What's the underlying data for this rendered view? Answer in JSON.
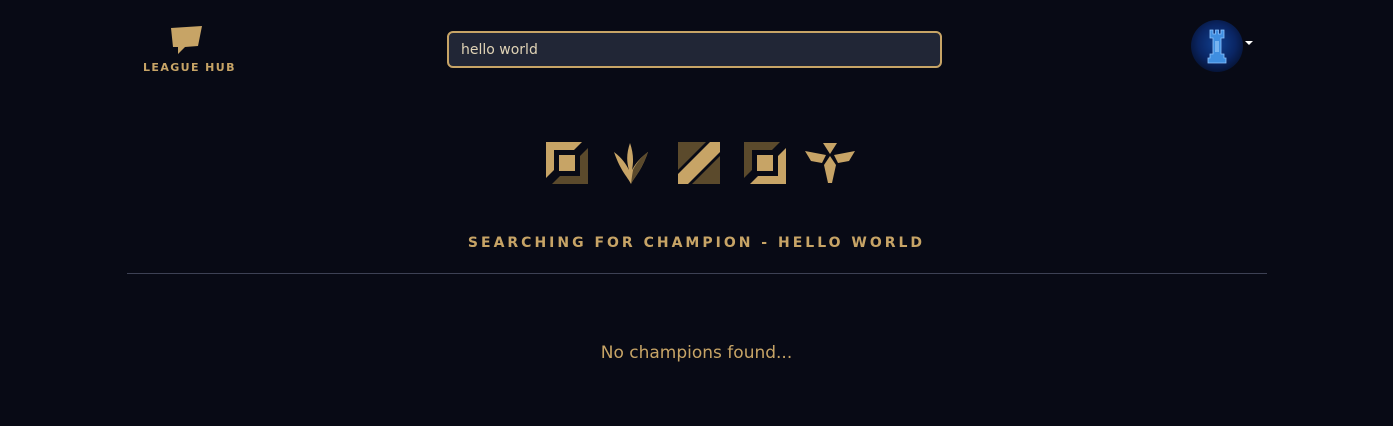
{
  "header": {
    "logo_text": "LEAGUE HUB",
    "search": {
      "value": "hello world",
      "placeholder": ""
    },
    "avatar_icon": "profile-avatar-icon"
  },
  "roles": {
    "items": [
      {
        "icon": "top-lane-icon"
      },
      {
        "icon": "jungle-icon"
      },
      {
        "icon": "mid-lane-icon"
      },
      {
        "icon": "bottom-lane-icon"
      },
      {
        "icon": "support-icon"
      }
    ]
  },
  "main": {
    "title": "SEARCHING FOR CHAMPION - HELLO WORLD",
    "empty_message": "No champions found..."
  },
  "colors": {
    "background": "#080a15",
    "accent": "#c7a466",
    "search_background": "#212636",
    "divider": "#3d4154"
  }
}
